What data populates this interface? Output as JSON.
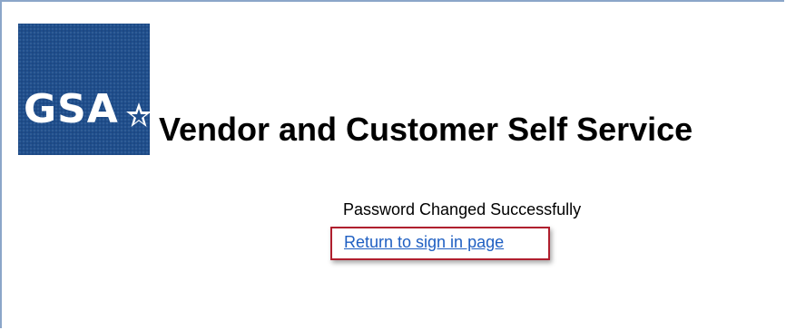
{
  "logo": {
    "text": "GSA",
    "icon": "gsa-star-icon",
    "color": "#1f4e8c"
  },
  "header": {
    "title": "Vendor and Customer Self Service"
  },
  "main": {
    "status_message": "Password Changed Successfully",
    "return_link_label": "Return to sign in page"
  },
  "colors": {
    "link": "#1f5fc2",
    "highlight": "#b01f2e"
  }
}
